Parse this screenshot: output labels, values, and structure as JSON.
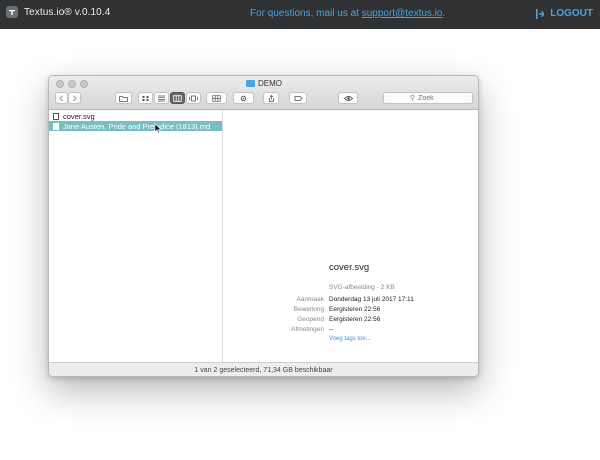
{
  "app": {
    "name": "Textus.io",
    "version_suffix": "® v.0.10.4",
    "notice_prefix": "For questions, mail us at ",
    "notice_email": "support@textus.io",
    "notice_suffix": ".",
    "logout_label": "LOGOUT",
    "accent": "#4aa3e0"
  },
  "finder": {
    "title": "DEMO",
    "search_placeholder": "Zoek",
    "files": [
      {
        "name": "cover.svg",
        "selected": false
      },
      {
        "name": "Jane Austen, Pride and Prejudice (1813).md",
        "selected": true
      }
    ],
    "preview": {
      "name": "cover.svg",
      "kind": "SVG-afbeelding - 2 KB",
      "rows": [
        {
          "key": "Aanmaak",
          "value": "Donderdag 13 juli 2017 17:11"
        },
        {
          "key": "Bewerking",
          "value": "Eergisteren 22:56"
        },
        {
          "key": "Geopend",
          "value": "Eergisteren 22:56"
        },
        {
          "key": "Afmetingen",
          "value": "--"
        }
      ],
      "tags_link": "Voeg tags toe..."
    },
    "status": "1 van 2 geselecteerd, 71,34 GB beschikbaar",
    "selection_color": "#79bec0"
  }
}
